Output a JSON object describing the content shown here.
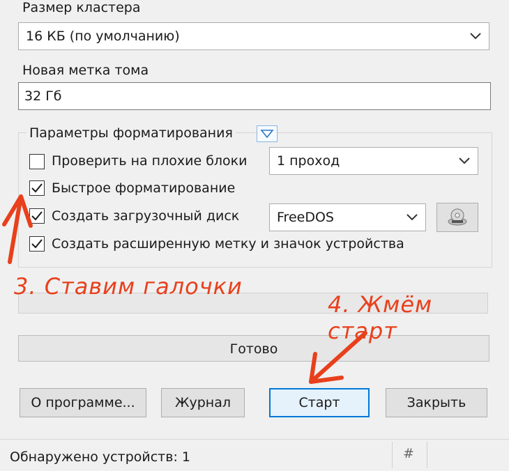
{
  "cluster_size": {
    "label": "Размер кластера",
    "value": "16 КБ (по умолчанию)"
  },
  "volume_label": {
    "label": "Новая метка тома",
    "value": "32 Гб"
  },
  "format_options": {
    "title": "Параметры форматирования",
    "bad_blocks": {
      "label": "Проверить на плохие блоки",
      "checked": false,
      "passes": "1 проход"
    },
    "quick_format": {
      "label": "Быстрое форматирование",
      "checked": true
    },
    "bootable": {
      "label": "Создать загрузочный диск",
      "checked": true,
      "type": "FreeDOS"
    },
    "extended_label": {
      "label": "Создать расширенную метку и значок устройства",
      "checked": true
    }
  },
  "progress": {
    "status": "Готово"
  },
  "buttons": {
    "about": "О программе...",
    "log": "Журнал",
    "start": "Старт",
    "close": "Закрыть"
  },
  "statusbar": {
    "devices": "Обнаружено устройств: 1",
    "hash": "#"
  },
  "annotations": {
    "step3": "3. Ставим галочки",
    "step4": "4. Жмём старт"
  },
  "colors": {
    "annotation": "#e8401c",
    "accent": "#0078d7"
  }
}
